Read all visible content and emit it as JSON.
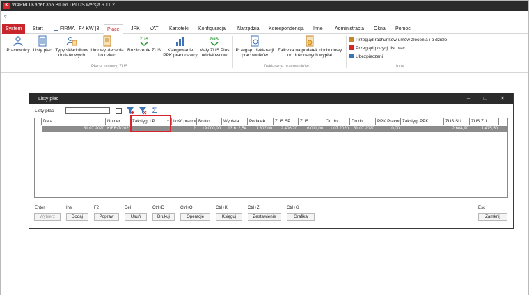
{
  "window": {
    "title": "WAPRO Kaper 365 BIURO PLUS wersja 9.11.2",
    "logo_letter": "K"
  },
  "qat": {
    "arrow": "▿"
  },
  "menu": {
    "system": "System",
    "items": [
      "Start",
      "FIRMA : F4 KW [3]",
      "Płace",
      "JPK",
      "VAT",
      "Kartoteki",
      "Konfiguracja",
      "Narzędzia",
      "Korespondencja",
      "Inne",
      "Administracja",
      "Okna",
      "Pomoc"
    ]
  },
  "ribbon": {
    "buttons": [
      {
        "label1": "Pracownicy",
        "label2": ""
      },
      {
        "label1": "Listy płac",
        "label2": ""
      },
      {
        "label1": "Typy składników",
        "label2": "dodatkowych"
      },
      {
        "label1": "Umowy zlecenia",
        "label2": "i o dzieło"
      },
      {
        "label1": "Rozliczenie ZUS",
        "label2": ""
      },
      {
        "label1": "Księgowanie",
        "label2": "PPK pracodawcy"
      },
      {
        "label1": "Mały ZUS Plus",
        "label2": "udziałowców"
      },
      {
        "label1": "Przegląd deklaracji",
        "label2": "pracowników"
      },
      {
        "label1": "Zaliczka na podatek dochodowy",
        "label2": "od dokonanych wypłat"
      }
    ],
    "zus_tag": "ZUS",
    "groups": {
      "place": "Płace, umowy, ZUS",
      "deklaracje": "Deklaracje pracowników",
      "inne": "Inne"
    },
    "small_buttons": [
      "Przegląd rachunków umów zlecenia i o dzieło",
      "Przegląd pozycji list płac",
      "Ubezpieczeni"
    ]
  },
  "dialog": {
    "title": "Listy płac",
    "filter_label": "Listy płac",
    "filter_value": "",
    "columns": [
      "",
      "Data",
      "Numer",
      "Zaksięg. LP",
      "Ilość pracow",
      "Brutto",
      "Wypłata",
      "Podatek",
      "ZUS SP",
      "ZUS",
      "Od dn.",
      "Do dn.",
      "PPK Pracodawcy",
      "Zaksięg. PPK",
      "ZUS SU",
      "ZUS ZU"
    ],
    "rows": [
      [
        "",
        "31.07.2020",
        "KIER/7/2020",
        "",
        "2",
        "19 000,00",
        "13 612,54",
        "1 307,00",
        "2 406,70",
        "6 011,00",
        "1.07.2020",
        "31.07.2020",
        "0,00",
        "",
        "2 604,90",
        "1 475,50"
      ]
    ],
    "shortcuts": [
      "Enter",
      "Ins",
      "F2",
      "Del",
      "Ctrl+D",
      "Ctrl+O",
      "Ctrl+K",
      "Ctrl+Z",
      "Ctrl+G",
      "Esc"
    ],
    "buttons": [
      "Wybierz",
      "Dodaj",
      "Popraw",
      "Usuń",
      "Drukuj",
      "Operacje",
      "Księguj",
      "Zestawienie",
      "Grafika",
      "Zamknij"
    ]
  }
}
